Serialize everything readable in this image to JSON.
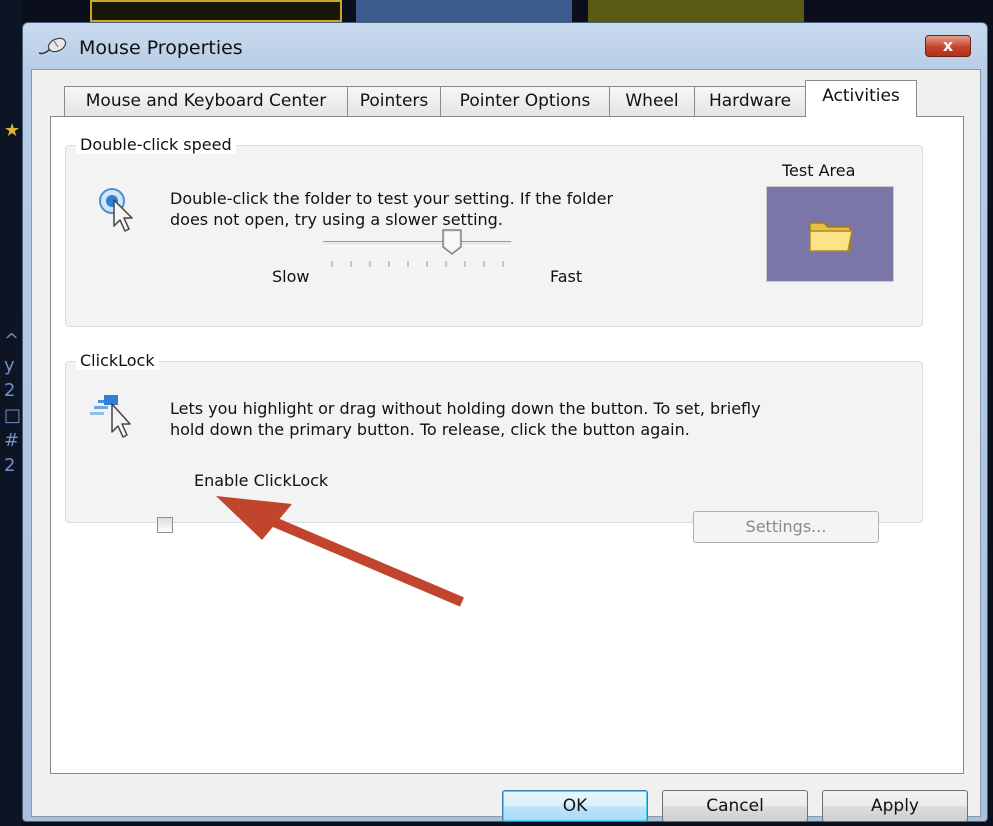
{
  "window": {
    "title": "Mouse Properties",
    "close_label": "x"
  },
  "tabs": [
    {
      "label": "Mouse and Keyboard Center"
    },
    {
      "label": "Pointers"
    },
    {
      "label": "Pointer Options"
    },
    {
      "label": "Wheel"
    },
    {
      "label": "Hardware"
    },
    {
      "label": "Activities"
    }
  ],
  "active_tab": "Activities",
  "double_click": {
    "group_label": "Double-click speed",
    "description_line1": "Double-click the folder to test your setting. If the folder",
    "description_line2": "does not open, try using a slower setting.",
    "test_area_label": "Test Area",
    "slider_min_label": "Slow",
    "slider_max_label": "Fast",
    "slider_value_fraction": 0.7
  },
  "clicklock": {
    "group_label": "ClickLock",
    "description_line1": "Lets you highlight or drag without holding down the button. To set, briefly",
    "description_line2": "hold down the primary button. To release, click the button again.",
    "checkbox_label": "Enable ClickLock",
    "checkbox_checked": false,
    "settings_label": "Settings..."
  },
  "buttons": {
    "ok": "OK",
    "cancel": "Cancel",
    "apply": "Apply"
  },
  "colors": {
    "annotation_arrow": "#c0452c",
    "test_area_bg": "#7a77a8",
    "default_button_border": "#3c7fb1"
  }
}
